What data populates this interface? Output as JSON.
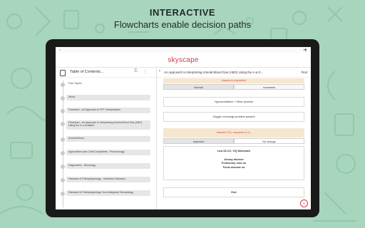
{
  "headline": {
    "line1": "INTERACTIVE",
    "line2": "Flowcharts enable decision paths"
  },
  "app": {
    "logo": "skyscape"
  },
  "sidebar": {
    "title": "Table of Contents...",
    "items": [
      {
        "label": "Free Topics"
      },
      {
        "label": "About"
      },
      {
        "label": "Flowchart - An Approach to PFT Interpretation"
      },
      {
        "label": "Flowchart - An Approach to Interpreting Arterial Blood Gas (ABG) Using the A-a Gradient"
      },
      {
        "label": "Arterial Blood"
      },
      {
        "label": "Approaches and Chief Complaints - Pulmonology"
      },
      {
        "label": "Diagnostics - Neurology"
      },
      {
        "label": "Diseases & Pathophysiology - Infectious Diseases"
      },
      {
        "label": "Diseases & Pathophysiology: Non-Malignant Hematology"
      }
    ]
  },
  "main": {
    "back": "‹",
    "title": "An Approach to Interpreting Arterial Blood Gas (ABG) Using the A-a G...",
    "find": "Find",
    "flow": {
      "assess_gradient": "Assess A-a gradient",
      "normal": "Normal",
      "increased": "Increased",
      "hypovent": "Hypoventilation + Other process",
      "oxygen": "Oxygen exchange problem present",
      "assess_pao2": "Assess PₐO₂ response to O₂",
      "improves": "Improves",
      "no_change": "No change",
      "low_dlco": "Low DLCO, V/Q Mismatch",
      "airway": "Airway disease",
      "pulmonary": "Pulmonary vasc dz",
      "focal": "Focal alveolar dz",
      "end": "End"
    }
  }
}
